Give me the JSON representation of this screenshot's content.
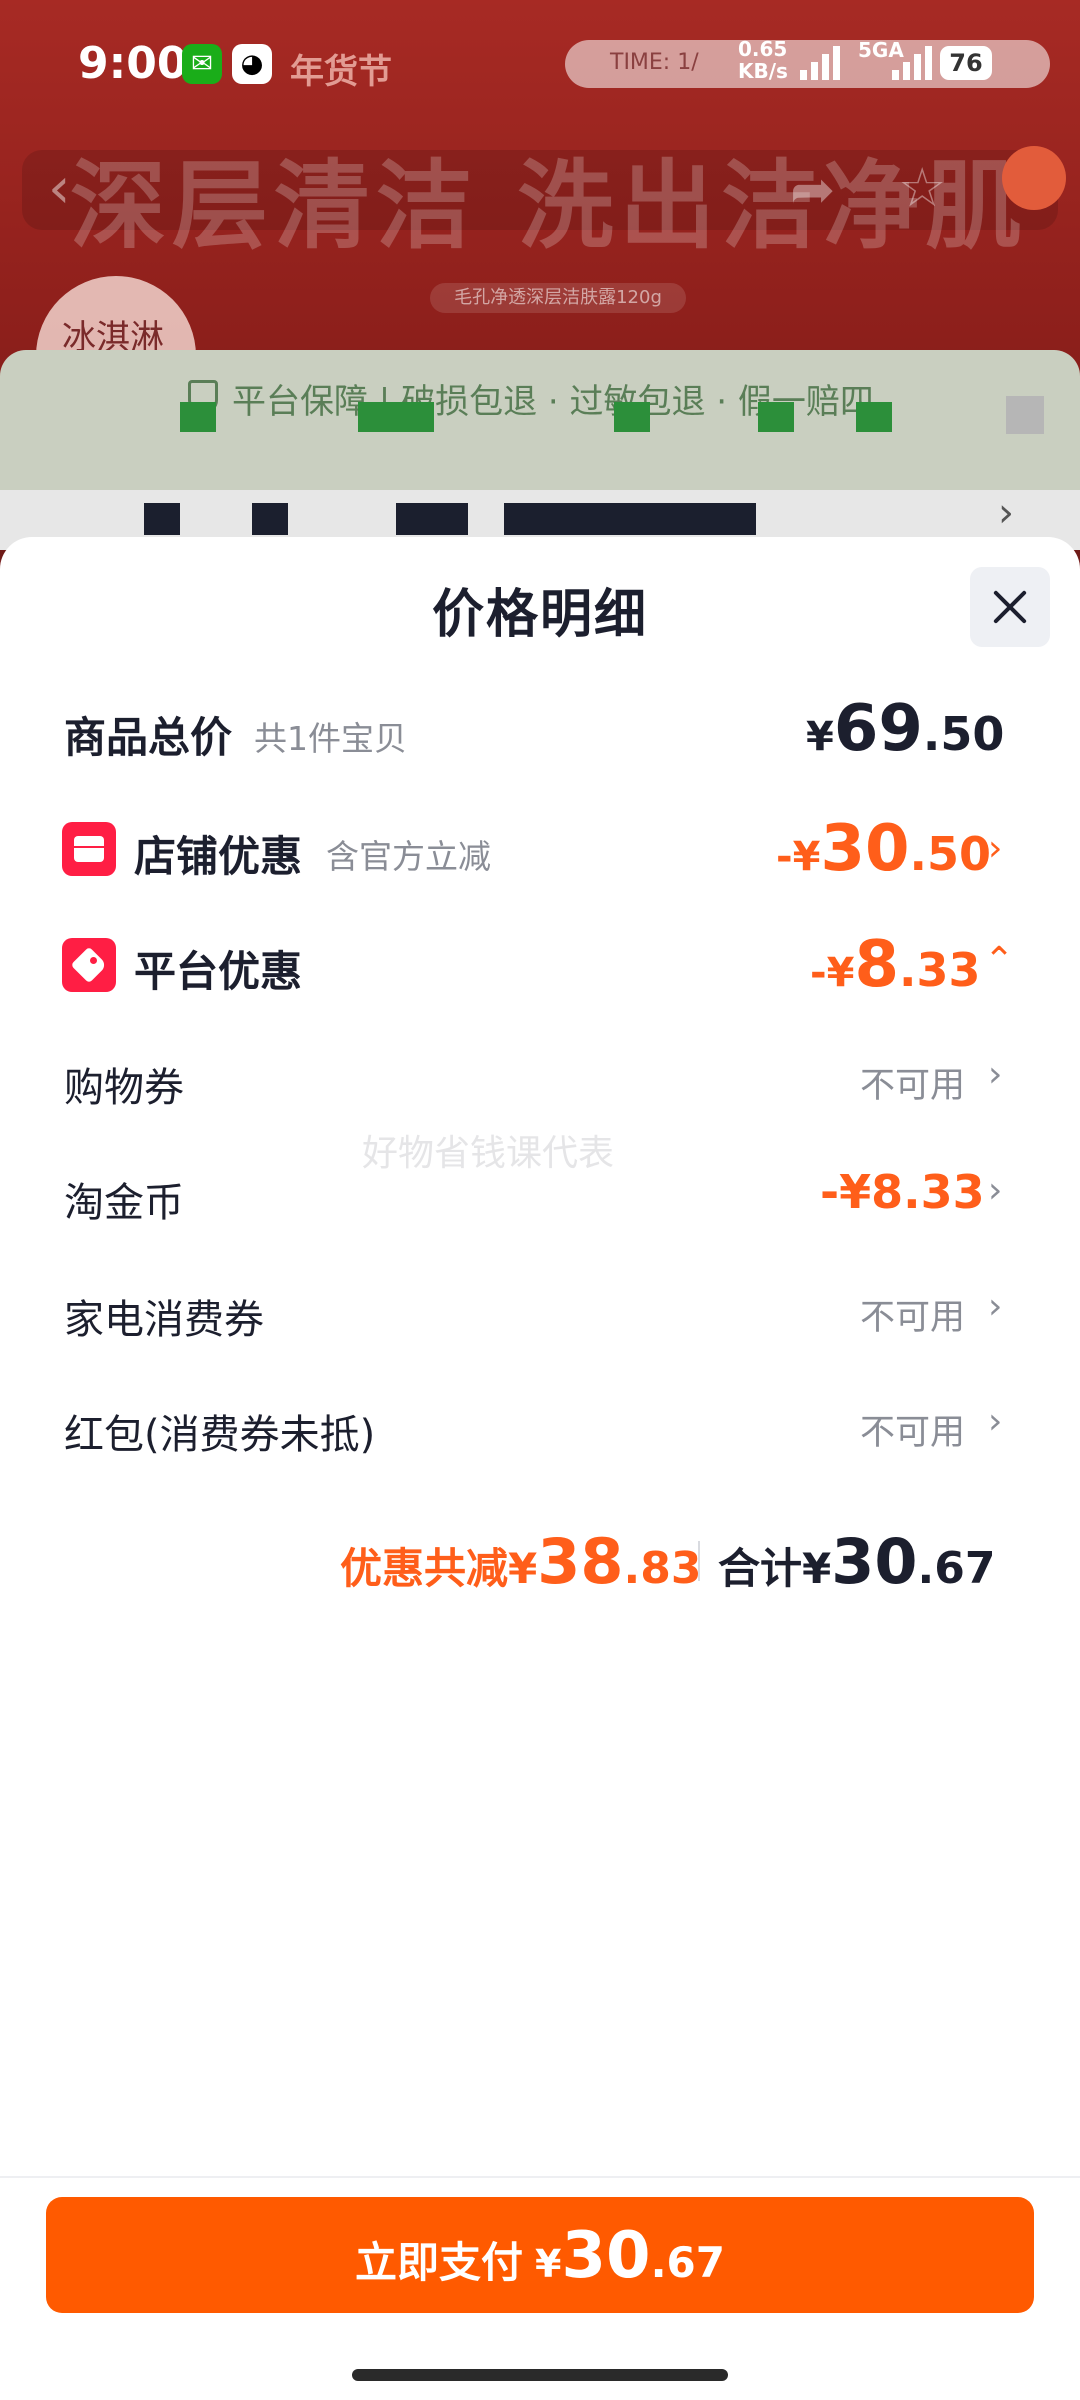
{
  "status_bar": {
    "time": "9:00",
    "wechat_icon": "wechat-icon",
    "qq_icon": "qq-icon",
    "festival": "年货节",
    "time_label": "TIME: 1/",
    "net_speed_line1": "0.65",
    "net_speed_line2": "KB/s",
    "net_type_1": "5G",
    "net_type_2": "5GA",
    "battery": "76"
  },
  "background_page": {
    "headline": "深层清洁 洗出洁净肌",
    "brand": "冰淇淋",
    "product_tag": "毛孔净透深层洁肤露120g",
    "guarantee": "平台保障 | 破损包退 · 过敏包退 · 假一赔四"
  },
  "sheet": {
    "title": "价格明细",
    "close_icon": "close-icon",
    "watermark": "好物省钱课代表",
    "rows": {
      "total_price": {
        "label": "商品总价",
        "sub": "共1件宝贝",
        "sym": "¥",
        "int": "69",
        "dec": ".50"
      },
      "store_discount": {
        "label": "店铺优惠",
        "sub": "含官方立减",
        "sym": "-¥",
        "int": "30",
        "dec": ".50",
        "icon": "store-icon"
      },
      "platform_discount": {
        "label": "平台优惠",
        "sym": "-¥",
        "int": "8",
        "dec": ".33",
        "icon": "tag-icon"
      },
      "shopping_coupon": {
        "label": "购物券",
        "value": "不可用"
      },
      "taojin_coins": {
        "label": "淘金币",
        "value": "-¥8.33"
      },
      "appliance_coupon": {
        "label": "家电消费券",
        "value": "不可用"
      },
      "red_packet": {
        "label": "红包(消费券未抵)",
        "value": "不可用"
      }
    },
    "summary": {
      "discount_label": "优惠共减",
      "discount_sym": "¥",
      "discount_int": "38",
      "discount_dec": ".83",
      "total_label": "合计",
      "total_sym": "¥",
      "total_int": "30",
      "total_dec": ".67"
    },
    "pay_button": {
      "label": "立即支付",
      "sym": "¥",
      "int": "30",
      "dec": ".67"
    }
  },
  "colors": {
    "accent_orange": "#ff5a00",
    "discount_orange": "#ff5e1a",
    "badge_red": "#ff1e44",
    "text_dark": "#1c1f2e",
    "text_grey": "#8a8d96"
  }
}
